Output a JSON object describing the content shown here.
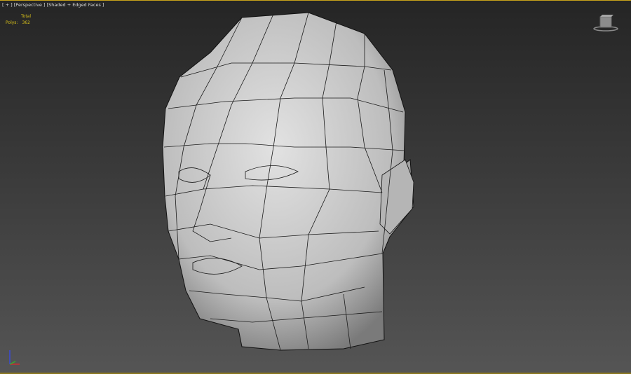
{
  "viewport": {
    "label_plus": "[ + ]",
    "label_view": "[Perspective ]",
    "label_shading": "[Shaded + Edged Faces ]",
    "stats": {
      "header": "Total",
      "polys_label": "Polys:",
      "polys_value": "362"
    },
    "colors": {
      "active_border": "#c8a21a",
      "stats_text": "#d9c21a",
      "mesh": "#c8c8c8",
      "edges": "#111111"
    },
    "icons": {
      "viewcube": "viewcube-icon",
      "axis": "axis-tripod-icon"
    }
  }
}
